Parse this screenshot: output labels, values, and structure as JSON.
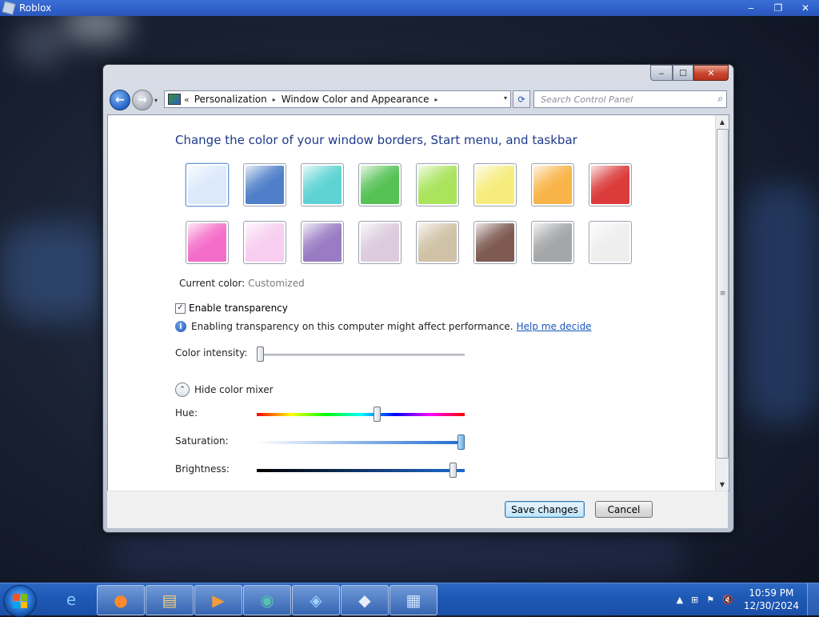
{
  "outer_window": {
    "title": "Roblox",
    "minimize_glyph": "‒",
    "restore_glyph": "❐",
    "close_glyph": "✕"
  },
  "dialog": {
    "controls": {
      "minimize_glyph": "‒",
      "maximize_glyph": "☐",
      "close_glyph": "✕"
    },
    "nav": {
      "back_glyph": "←",
      "forward_glyph": "→",
      "history_glyph": "▾"
    },
    "address": {
      "chevron": "«",
      "crumbs": [
        "Personalization",
        "Window Color and Appearance"
      ],
      "separator": "▸",
      "dropdown_glyph": "▾",
      "refresh_glyph": "⟳"
    },
    "search": {
      "placeholder": "Search Control Panel",
      "value": "",
      "icon_glyph": "⌕"
    },
    "heading": "Change the color of your window borders, Start menu, and taskbar",
    "swatches": {
      "row1": [
        {
          "name": "sky",
          "color": "#dbe9fb"
        },
        {
          "name": "twilight",
          "color": "#4f7fc8"
        },
        {
          "name": "sea",
          "color": "#5fd3d3"
        },
        {
          "name": "leaf",
          "color": "#56c256"
        },
        {
          "name": "lime",
          "color": "#a9e45c"
        },
        {
          "name": "lemon",
          "color": "#f6ec7d"
        },
        {
          "name": "pumpkin",
          "color": "#f8b448"
        },
        {
          "name": "ruby",
          "color": "#dc3b3b"
        }
      ],
      "row2": [
        {
          "name": "fuchsia",
          "color": "#f46ec9"
        },
        {
          "name": "blush",
          "color": "#f7cdf0"
        },
        {
          "name": "violet",
          "color": "#9a7cc4"
        },
        {
          "name": "lavender",
          "color": "#dbcbdd"
        },
        {
          "name": "taupe",
          "color": "#cfc2a6"
        },
        {
          "name": "chocolate",
          "color": "#7e5a52"
        },
        {
          "name": "slate",
          "color": "#a4a6a8"
        },
        {
          "name": "frost",
          "color": "#eeeeee"
        }
      ]
    },
    "current_color": {
      "label": "Current color:",
      "value": "Customized"
    },
    "transparency": {
      "label": "Enable transparency",
      "checked": true,
      "check_glyph": "✓"
    },
    "info": {
      "icon_glyph": "i",
      "text": "Enabling transparency on this computer might affect performance.",
      "link": "Help me decide"
    },
    "color_intensity": {
      "label": "Color intensity:",
      "value_percent": 0
    },
    "mixer_toggle": {
      "label": "Hide color mixer",
      "glyph": "⌃"
    },
    "mixer": {
      "hue": {
        "label": "Hue:",
        "value_percent": 58
      },
      "saturation": {
        "label": "Saturation:",
        "value_percent": 100
      },
      "brightness": {
        "label": "Brightness:",
        "value_percent": 96
      }
    },
    "buttons": {
      "save": "Save changes",
      "cancel": "Cancel"
    },
    "scrollbar": {
      "up_glyph": "▲",
      "down_glyph": "▼",
      "grip_glyph": "≡"
    }
  },
  "taskbar": {
    "items": [
      {
        "name": "internet-explorer",
        "glyph": "e"
      },
      {
        "name": "firefox",
        "glyph": "●"
      },
      {
        "name": "file-explorer",
        "glyph": "▤"
      },
      {
        "name": "media-player",
        "glyph": "▶"
      },
      {
        "name": "app",
        "glyph": "◉"
      },
      {
        "name": "roblox-studio",
        "glyph": "◈"
      },
      {
        "name": "roblox",
        "glyph": "◆"
      },
      {
        "name": "control-panel",
        "glyph": "▦"
      }
    ],
    "tray": {
      "show_hidden_glyph": "▲",
      "network_glyph": "⊞",
      "flag_glyph": "⚑",
      "volume_glyph": "🔇"
    },
    "clock": {
      "time": "10:59 PM",
      "date": "12/30/2024"
    }
  }
}
